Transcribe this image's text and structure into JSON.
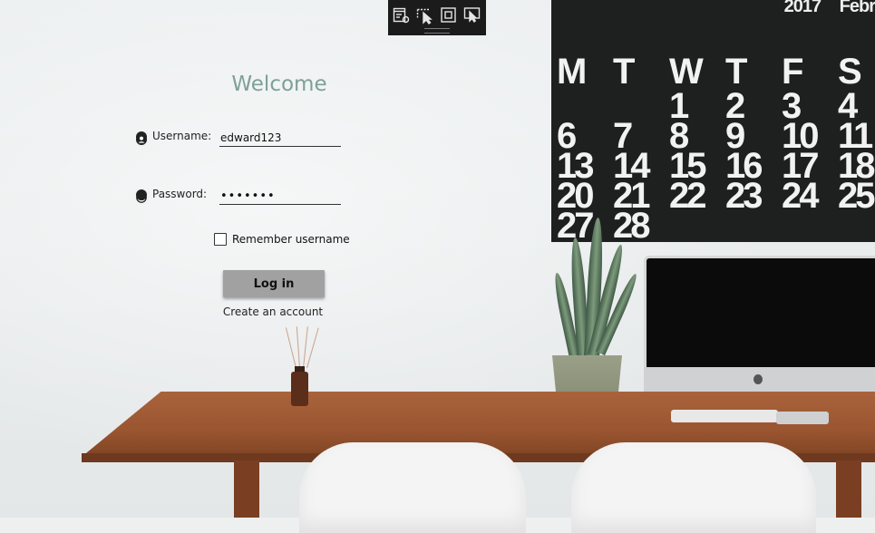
{
  "toolbar": {
    "buttons": [
      {
        "name": "window-settings-icon"
      },
      {
        "name": "select-pointer-icon"
      },
      {
        "name": "frame-icon"
      },
      {
        "name": "screen-pointer-icon"
      }
    ]
  },
  "background": {
    "calendar": {
      "year": "2017",
      "month": "Febr",
      "day_names": [
        "M",
        "T",
        "W",
        "T",
        "F",
        "S"
      ],
      "weeks": [
        [
          "",
          "",
          "1",
          "2",
          "3",
          "4"
        ],
        [
          "6",
          "7",
          "8",
          "9",
          "10",
          "11"
        ],
        [
          "13",
          "14",
          "15",
          "16",
          "17",
          "18"
        ],
        [
          "20",
          "21",
          "22",
          "23",
          "24",
          "25"
        ],
        [
          "27",
          "28",
          "",
          "",
          "",
          ""
        ]
      ]
    }
  },
  "login": {
    "title": "Welcome",
    "username_label": "Username:",
    "username_value": "edward123",
    "password_label": "Password:",
    "password_value": "•••••••",
    "remember_label": "Remember username",
    "remember_checked": false,
    "login_button": "Log in",
    "create_account": "Create an account"
  },
  "colors": {
    "title": "#7fa097",
    "button": "#a1a1a1",
    "toolbar": "#1b1b1b"
  }
}
